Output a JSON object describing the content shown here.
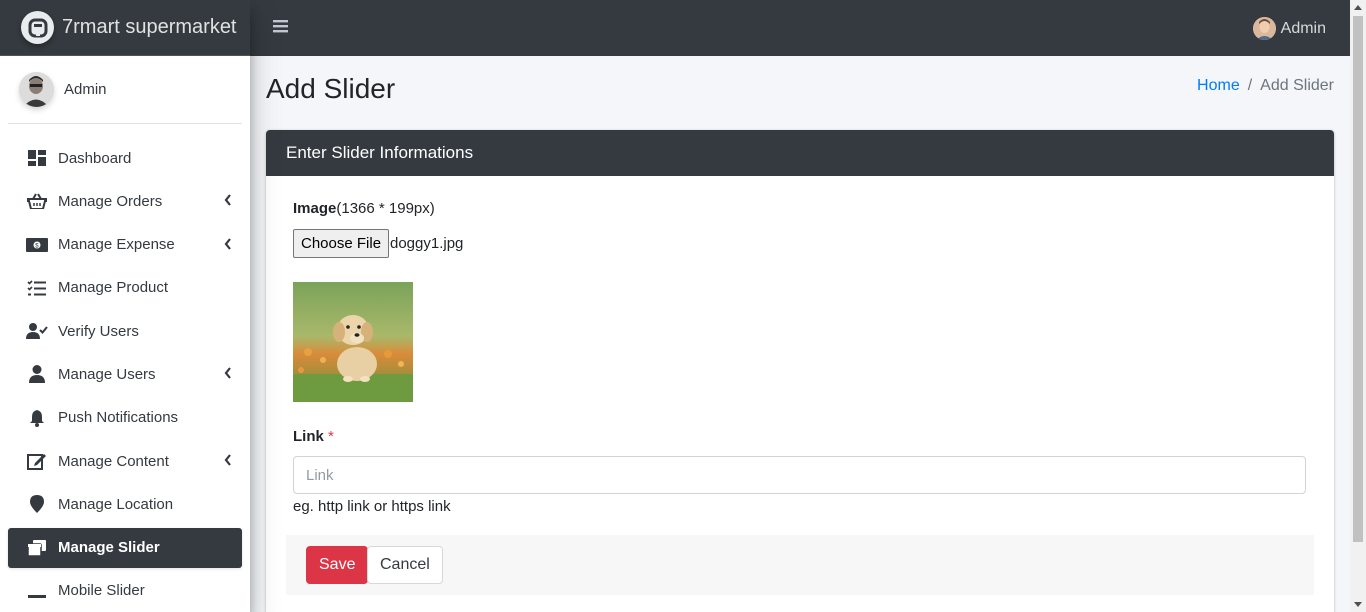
{
  "brand": {
    "name": "7rmart supermarket"
  },
  "sidebar": {
    "user_name": "Admin",
    "items": [
      {
        "label": "Dashboard",
        "icon": "dashboard-icon",
        "has_submenu": false,
        "active": false
      },
      {
        "label": "Manage Orders",
        "icon": "basket-icon",
        "has_submenu": true,
        "active": false
      },
      {
        "label": "Manage Expense",
        "icon": "money-bill-icon",
        "has_submenu": true,
        "active": false
      },
      {
        "label": "Manage Product",
        "icon": "tasks-icon",
        "has_submenu": false,
        "active": false
      },
      {
        "label": "Verify Users",
        "icon": "user-check-icon",
        "has_submenu": false,
        "active": false
      },
      {
        "label": "Manage Users",
        "icon": "user-icon",
        "has_submenu": true,
        "active": false
      },
      {
        "label": "Push Notifications",
        "icon": "bell-icon",
        "has_submenu": false,
        "active": false
      },
      {
        "label": "Manage Content",
        "icon": "edit-icon",
        "has_submenu": true,
        "active": false
      },
      {
        "label": "Manage Location",
        "icon": "map-marker-icon",
        "has_submenu": false,
        "active": false
      },
      {
        "label": "Manage Slider",
        "icon": "window-restore-icon",
        "has_submenu": false,
        "active": true
      },
      {
        "label": "Mobile Slider",
        "icon": "minus-icon",
        "has_submenu": false,
        "active": false
      }
    ]
  },
  "topbar": {
    "user_name": "Admin"
  },
  "page": {
    "title": "Add Slider",
    "breadcrumb": {
      "home": "Home",
      "separator": "/",
      "current": "Add Slider"
    }
  },
  "card": {
    "header": "Enter Slider Informations",
    "image_label": "Image",
    "image_hint": "(1366 * 199px)",
    "file_button": "Choose File",
    "file_name": "doggy1.jpg",
    "link_label": "Link",
    "required_mark": "*",
    "link_placeholder": "Link",
    "link_value": "",
    "link_help": "eg. http link or https link",
    "save_label": "Save",
    "cancel_label": "Cancel"
  },
  "colors": {
    "dark": "#343a40",
    "primary_link": "#007bff",
    "danger": "#dc3545",
    "content_bg": "#f4f6f9"
  }
}
